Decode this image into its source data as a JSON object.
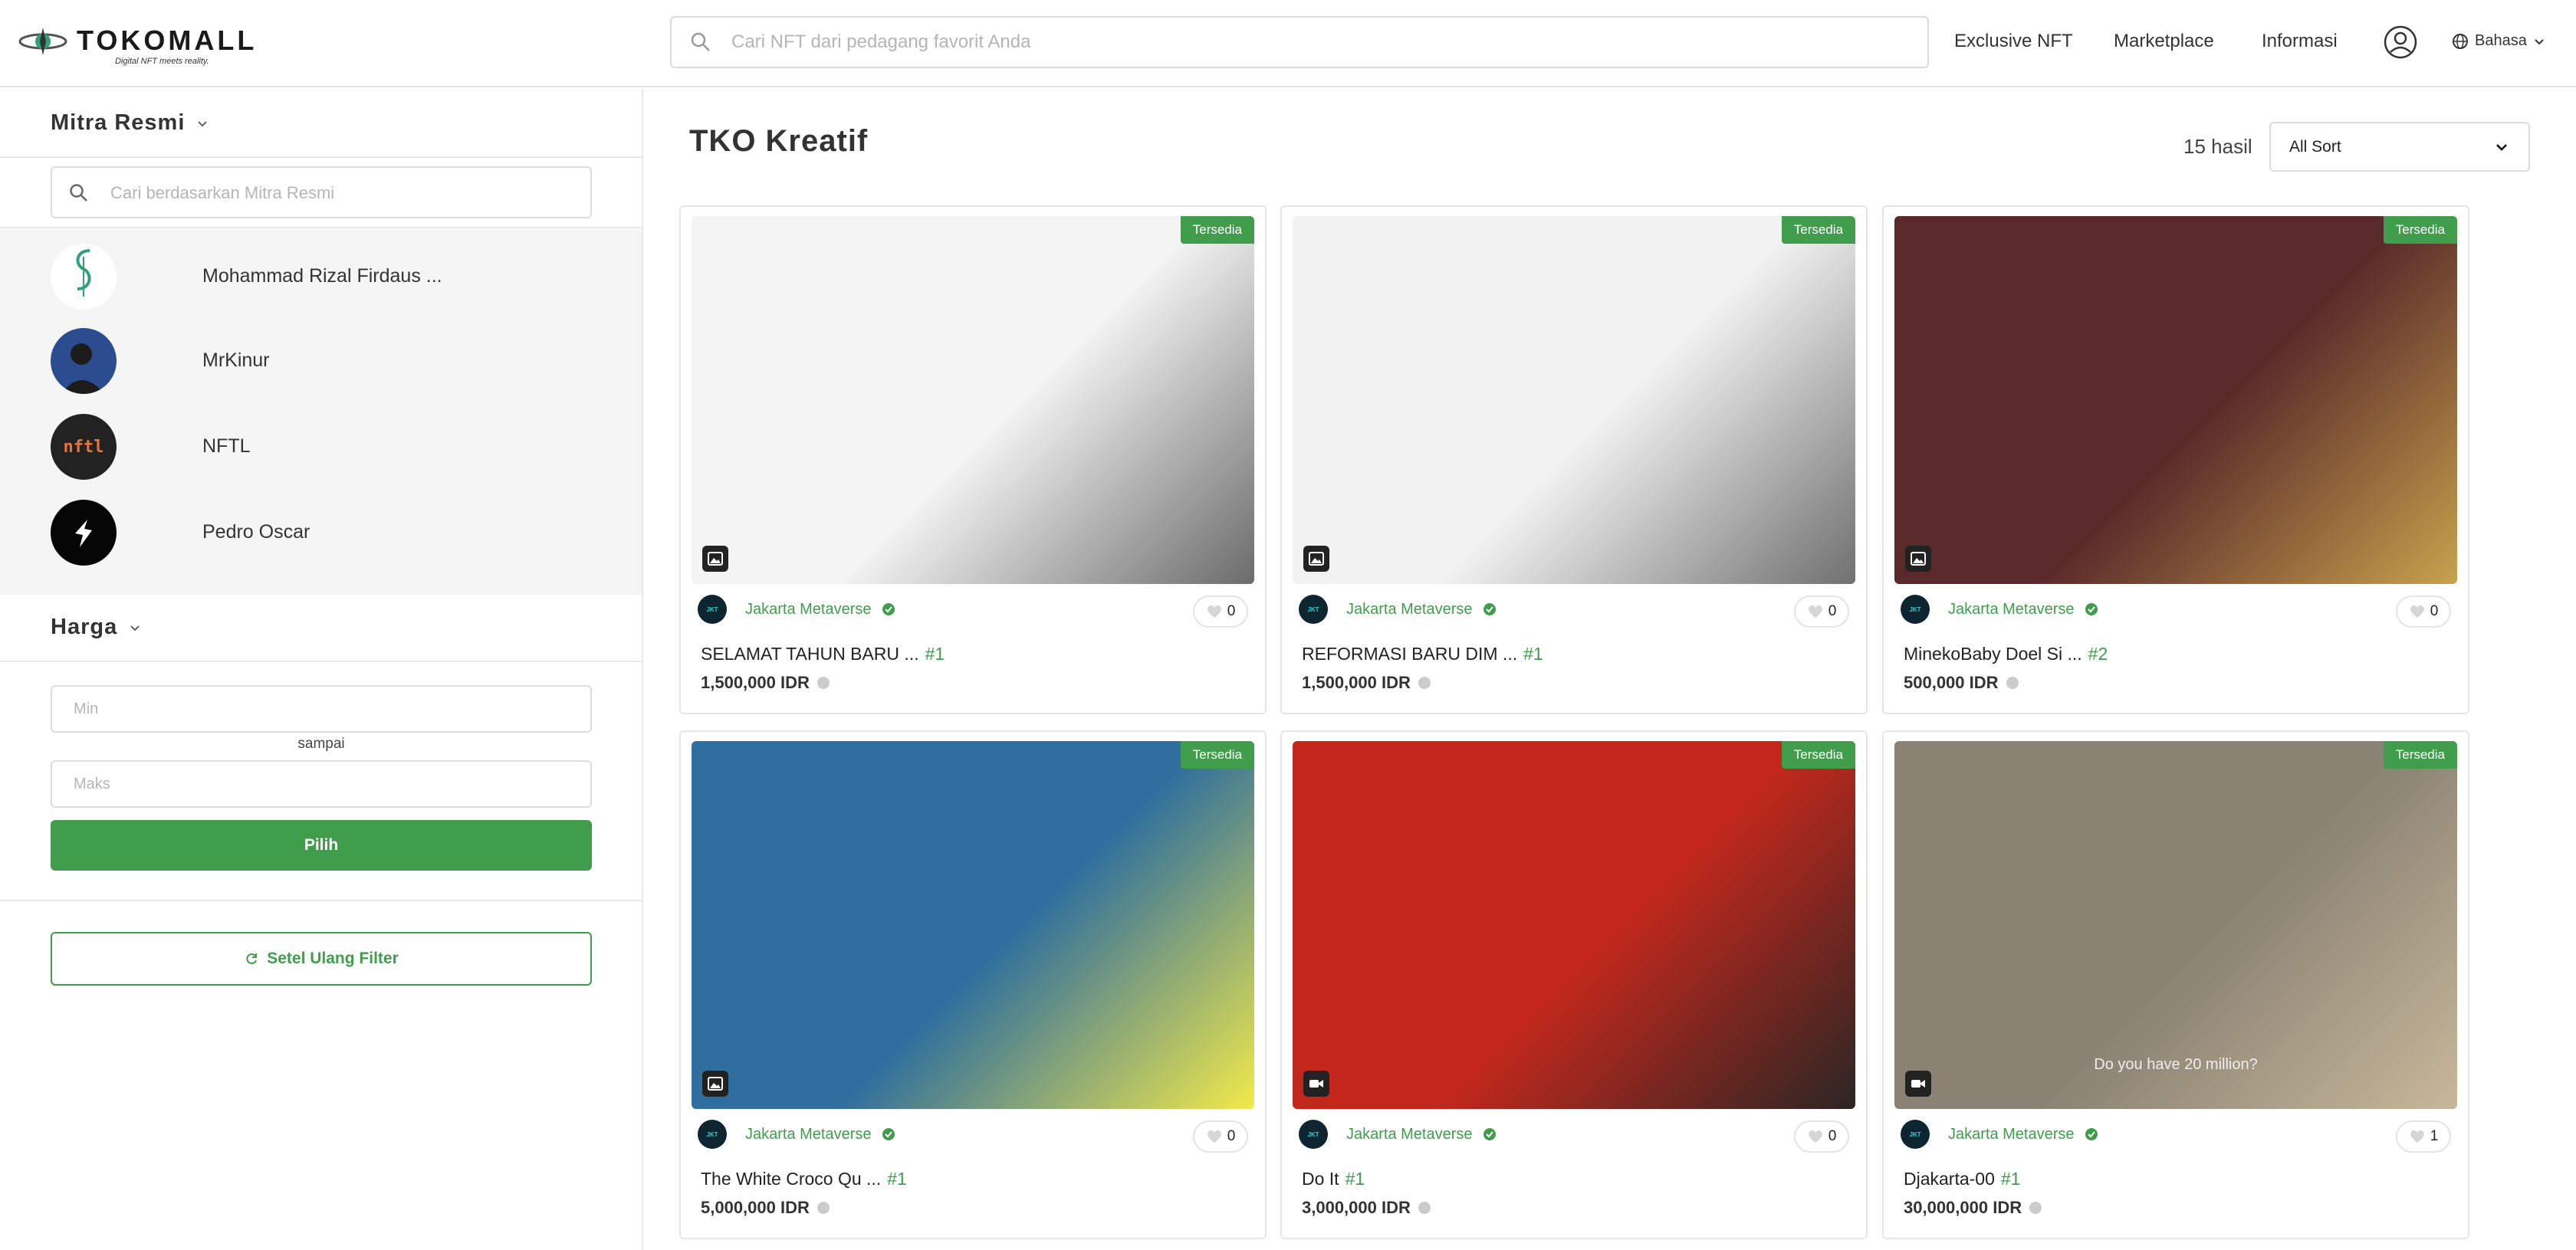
{
  "header": {
    "logo_text": "TOKOMALL",
    "logo_tagline": "Digital NFT meets reality.",
    "search_placeholder": "Cari NFT dari pedagang favorit Anda",
    "nav": [
      "Exclusive NFT",
      "Marketplace",
      "Informasi"
    ],
    "language_label": "Bahasa"
  },
  "sidebar": {
    "partners_heading": "Mitra Resmi",
    "partner_search_placeholder": "Cari berdasarkan Mitra Resmi",
    "partners": [
      {
        "name": "Mohammad Rizal Firdaus ..."
      },
      {
        "name": "MrKinur"
      },
      {
        "name": "NFTL",
        "avatar_text": "nftl"
      },
      {
        "name": "Pedro Oscar"
      }
    ],
    "price_heading": "Harga",
    "min_placeholder": "Min",
    "between_label": "sampai",
    "max_placeholder": "Maks",
    "apply_label": "Pilih",
    "reset_label": "Setel Ulang Filter"
  },
  "main": {
    "title": "TKO Kreatif",
    "results_count": "15 hasil",
    "sort_value": "All Sort",
    "badge_label": "Tersedia",
    "seller_avatar_text": "JKT",
    "cards": [
      {
        "seller": "Jakarta Metaverse",
        "likes": "0",
        "title": "SELAMAT TAHUN BARU ...",
        "edition": "#1",
        "price": "1,500,000 IDR",
        "media": "image",
        "color_a": "#f4f4f4",
        "color_b": "#6b6b6b"
      },
      {
        "seller": "Jakarta Metaverse",
        "likes": "0",
        "title": "REFORMASI BARU DIM ...",
        "edition": "#1",
        "price": "1,500,000 IDR",
        "media": "image",
        "color_a": "#f2f2f2",
        "color_b": "#707070"
      },
      {
        "seller": "Jakarta Metaverse",
        "likes": "0",
        "title": "MinekoBaby Doel Si ...",
        "edition": "#2",
        "price": "500,000 IDR",
        "media": "image",
        "color_a": "#5a2a2a",
        "color_b": "#c7a24d"
      },
      {
        "seller": "Jakarta Metaverse",
        "likes": "0",
        "title": "The White Croco Qu ...",
        "edition": "#1",
        "price": "5,000,000 IDR",
        "media": "image",
        "color_a": "#2f6e9e",
        "color_b": "#f2e94a"
      },
      {
        "seller": "Jakarta Metaverse",
        "likes": "0",
        "title": "Do It",
        "edition": "#1",
        "price": "3,000,000 IDR",
        "media": "video",
        "color_a": "#c3271c",
        "color_b": "#2b2624"
      },
      {
        "seller": "Jakarta Metaverse",
        "likes": "1",
        "title": "Djakarta-00",
        "edition": "#1",
        "price": "30,000,000 IDR",
        "media": "video",
        "color_a": "#8a8373",
        "color_b": "#c7b79a",
        "caption": "Do you have 20 million?"
      }
    ]
  },
  "colors": {
    "accent": "#3f9d4b",
    "border": "#e4e4e4"
  }
}
